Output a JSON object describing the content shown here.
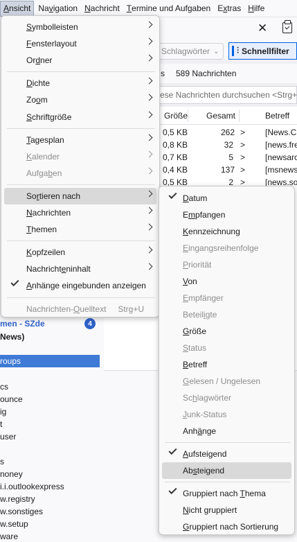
{
  "menubar": [
    {
      "pre": "",
      "u": "A",
      "post": "nsicht"
    },
    {
      "pre": "Na",
      "u": "v",
      "post": "igation"
    },
    {
      "pre": "",
      "u": "N",
      "post": "achricht"
    },
    {
      "pre": "",
      "u": "T",
      "post": "ermine und Aufgaben"
    },
    {
      "pre": "E",
      "u": "x",
      "post": "tras"
    },
    {
      "pre": "",
      "u": "H",
      "post": "ilfe"
    }
  ],
  "toolbar": {
    "tags_label": "Schlagwörter",
    "quick_filter_label": "Schnellfilter"
  },
  "list": {
    "count_suffix": "s",
    "message_count": "589 Nachrichten",
    "search_placeholder": "ese Nachrichten durchsuchen <Strg+",
    "columns": {
      "size": "Größe",
      "total": "Gesamt",
      "subject": "Betreff"
    },
    "rows": [
      {
        "size": "0,5 KB",
        "total": "262",
        "subject": "[News.C"
      },
      {
        "size": "0,8 KB",
        "total": "32",
        "subject": "[news.fre"
      },
      {
        "size": "0,7 KB",
        "total": "5",
        "subject": "[newsarc"
      },
      {
        "size": "0,4 KB",
        "total": "137",
        "subject": "[msnews"
      },
      {
        "size": "0,5 KB",
        "total": "2",
        "subject": "[news.so"
      }
    ]
  },
  "sidebar": {
    "account": "men - SZde",
    "badge": "4",
    "news": "News)",
    "groups": "roups",
    "items": [
      "cs",
      "ounce",
      "ig",
      "t",
      "user",
      "",
      "s",
      "noney",
      "i.i.outlookexpress",
      "w.registry",
      "w.sonstiges",
      "w.setup",
      "ware"
    ]
  },
  "view_menu": [
    {
      "pre": "",
      "u": "S",
      "post": "ymbolleisten",
      "arrow": true
    },
    {
      "pre": "",
      "u": "F",
      "post": "ensterlayout",
      "arrow": true
    },
    {
      "pre": "Or",
      "u": "d",
      "post": "ner",
      "arrow": true
    },
    {
      "sep": true
    },
    {
      "pre": "",
      "u": "D",
      "post": "ichte",
      "arrow": true
    },
    {
      "pre": "Zo",
      "u": "o",
      "post": "m",
      "arrow": true
    },
    {
      "pre": "",
      "u": "S",
      "post": "chriftgröße",
      "arrow": true
    },
    {
      "sep": true
    },
    {
      "pre": "",
      "u": "T",
      "post": "agesplan",
      "arrow": true
    },
    {
      "pre": "",
      "u": "K",
      "post": "alender",
      "arrow": true,
      "disabled": true
    },
    {
      "pre": "Aufga",
      "u": "b",
      "post": "en",
      "arrow": true,
      "disabled": true
    },
    {
      "sep": true
    },
    {
      "pre": "So",
      "u": "r",
      "post": "tieren nach",
      "arrow": true,
      "highlight": true
    },
    {
      "pre": "",
      "u": "N",
      "post": "achrichten",
      "arrow": true
    },
    {
      "pre": "",
      "u": "T",
      "post": "hemen",
      "arrow": true
    },
    {
      "sep": true
    },
    {
      "pre": "",
      "u": "K",
      "post": "opfzeilen",
      "arrow": true
    },
    {
      "pre": "Nachricht",
      "u": "e",
      "post": "ninhalt",
      "arrow": true
    },
    {
      "pre": "",
      "u": "A",
      "post": "nhänge eingebunden anzeigen",
      "check": true
    },
    {
      "sep": true
    },
    {
      "pre": "Nachrichten-",
      "u": "Q",
      "post": "uelltext",
      "accel": "Strg+U",
      "disabled": true
    }
  ],
  "sort_menu": [
    {
      "pre": "",
      "u": "D",
      "post": "atum",
      "check": true
    },
    {
      "pre": "E",
      "u": "m",
      "post": "pfangen"
    },
    {
      "pre": "",
      "u": "K",
      "post": "ennzeichnung"
    },
    {
      "pre": "",
      "u": "E",
      "post": "ingangsreihenfolge",
      "disabled": true
    },
    {
      "pre": "",
      "u": "P",
      "post": "riorität",
      "disabled": true
    },
    {
      "pre": "",
      "u": "V",
      "post": "on"
    },
    {
      "pre": "",
      "u": "E",
      "post": "mpfänger",
      "disabled": true
    },
    {
      "pre": "Beteil",
      "u": "i",
      "post": "gte",
      "disabled": true
    },
    {
      "pre": "",
      "u": "G",
      "post": "röße"
    },
    {
      "pre": "",
      "u": "S",
      "post": "tatus",
      "disabled": true
    },
    {
      "pre": "",
      "u": "B",
      "post": "etreff"
    },
    {
      "pre": "",
      "u": "G",
      "post": "elesen / Ungelesen",
      "disabled": true
    },
    {
      "pre": "Sc",
      "u": "h",
      "post": "lagwörter",
      "disabled": true
    },
    {
      "pre": "",
      "u": "J",
      "post": "unk-Status",
      "disabled": true
    },
    {
      "pre": "Anh",
      "u": "ä",
      "post": "nge"
    },
    {
      "sep": true
    },
    {
      "pre": "",
      "u": "A",
      "post": "ufsteigend",
      "check": true
    },
    {
      "pre": "Ab",
      "u": "s",
      "post": "teigend",
      "highlight": true
    },
    {
      "sep": true
    },
    {
      "pre": "Gruppiert nach ",
      "u": "T",
      "post": "hema",
      "check": true
    },
    {
      "pre": "",
      "u": "N",
      "post": "icht gruppiert"
    },
    {
      "pre": "",
      "u": "G",
      "post": "ruppiert nach Sortierung"
    }
  ]
}
